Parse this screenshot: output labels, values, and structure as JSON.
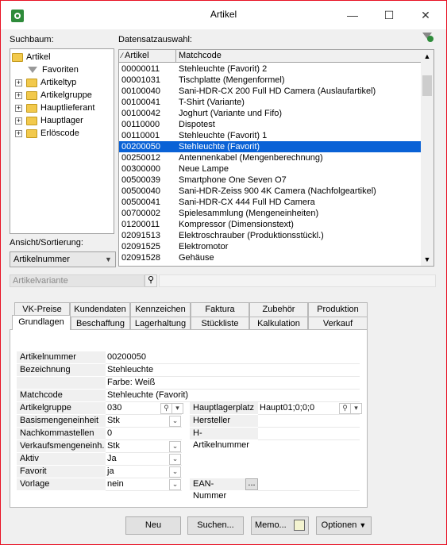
{
  "window": {
    "title": "Artikel",
    "minimize": "—",
    "maximize": "☐",
    "close": "✕"
  },
  "suchbaum": {
    "label": "Suchbaum:",
    "items": [
      {
        "label": "Artikel"
      },
      {
        "label": "Favoriten"
      },
      {
        "label": "Artikeltyp"
      },
      {
        "label": "Artikelgruppe"
      },
      {
        "label": "Hauptlieferant"
      },
      {
        "label": "Hauptlager"
      },
      {
        "label": "Erlöscode"
      }
    ]
  },
  "ansicht": {
    "label": "Ansicht/Sortierung:",
    "value": "Artikelnummer"
  },
  "datensatz": {
    "label": "Datensatzauswahl:",
    "columns": [
      "Artikel",
      "Matchcode"
    ],
    "rows": [
      [
        "00000011",
        "Stehleuchte  (Favorit) 2"
      ],
      [
        "00001031",
        "Tischplatte (Mengenformel)"
      ],
      [
        "00100040",
        "Sani-HDR-CX 200 Full HD Camera (Auslaufartikel)"
      ],
      [
        "00100041",
        "T-Shirt (Variante)"
      ],
      [
        "00100042",
        "Joghurt (Variante und Fifo)"
      ],
      [
        "00110000",
        "Dispotest"
      ],
      [
        "00110001",
        "Stehleuchte  (Favorit) 1"
      ],
      [
        "00200050",
        "Stehleuchte  (Favorit)"
      ],
      [
        "00250012",
        "Antennenkabel (Mengenberechnung)"
      ],
      [
        "00300000",
        "Neue Lampe"
      ],
      [
        "00500039",
        "Smartphone One Seven O7"
      ],
      [
        "00500040",
        "Sani-HDR-Zeiss 900 4K Camera (Nachfolgeartikel)"
      ],
      [
        "00500041",
        "Sani-HDR-CX 444 Full HD Camera"
      ],
      [
        "00700002",
        "Spielesammlung (Mengeneinheiten)"
      ],
      [
        "01200011",
        "Kompressor (Dimensionstext)"
      ],
      [
        "02091513",
        "Elektroschrauber (Produktionsstückl.)"
      ],
      [
        "02091525",
        "Elektromotor"
      ],
      [
        "02091528",
        "Gehäuse"
      ]
    ],
    "selected_index": 7
  },
  "variante": {
    "placeholder": "Artikelvariante"
  },
  "tabs_top": [
    "VK-Preise",
    "Kundendaten",
    "Kennzeichen",
    "Faktura",
    "Zubehör",
    "Produktion"
  ],
  "tabs_bottom": [
    "Grundlagen",
    "Beschaffung",
    "Lagerhaltung",
    "Stückliste",
    "Kalkulation",
    "Verkauf"
  ],
  "fields": {
    "artikelnummer": {
      "label": "Artikelnummer",
      "value": "00200050"
    },
    "bezeichnung": {
      "label": "Bezeichnung",
      "value": "Stehleuchte",
      "value2": "Farbe: Weiß"
    },
    "matchcode": {
      "label": "Matchcode",
      "value": "Stehleuchte  (Favorit)"
    },
    "artikelgruppe": {
      "label": "Artikelgruppe",
      "value": "030"
    },
    "basismengeneinheit": {
      "label": "Basismengeneinheit",
      "value": "Stk"
    },
    "nachkommastellen": {
      "label": "Nachkommastellen",
      "value": "0"
    },
    "verkaufsmengeneinheit": {
      "label": "Verkaufsmengeneinh.",
      "value": "Stk"
    },
    "aktiv": {
      "label": "Aktiv",
      "value": "Ja"
    },
    "favorit": {
      "label": "Favorit",
      "value": "ja"
    },
    "vorlage": {
      "label": "Vorlage",
      "value": "nein"
    },
    "hauptlagerplatz": {
      "label": "Hauptlagerplatz",
      "value": "Haupt01;0;0;0"
    },
    "hersteller": {
      "label": "Hersteller",
      "value": ""
    },
    "h_artikelnummer": {
      "label": "H-Artikelnummer",
      "value": ""
    },
    "ean": {
      "label": "EAN-Nummer",
      "btn": "..."
    }
  },
  "buttons": {
    "neu": "Neu",
    "suchen": "Suchen...",
    "memo": "Memo...",
    "optionen": "Optionen"
  }
}
